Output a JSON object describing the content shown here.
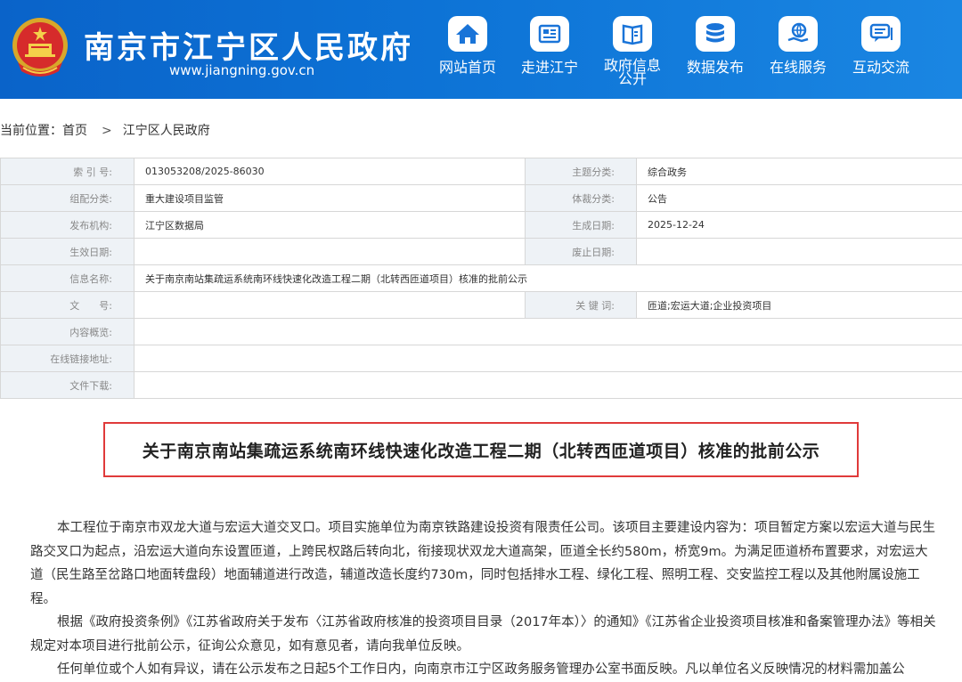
{
  "header": {
    "site_title": "南京市江宁区人民政府",
    "site_url": "www.jiangning.gov.cn",
    "nav": [
      {
        "label": "网站首页",
        "icon": "home-icon"
      },
      {
        "label": "走进江宁",
        "icon": "newspaper-icon"
      },
      {
        "label": "政府信息公开",
        "icon": "book-icon"
      },
      {
        "label": "数据发布",
        "icon": "database-icon"
      },
      {
        "label": "在线服务",
        "icon": "globe-hand-icon"
      },
      {
        "label": "互动交流",
        "icon": "chat-icon"
      }
    ]
  },
  "breadcrumb": {
    "prefix": "当前位置：",
    "home": "首页",
    "separator": ">",
    "current": "江宁区人民政府"
  },
  "meta": {
    "index_label": "索 引 号:",
    "index_value": "013053208/2025-86030",
    "topic_label": "主题分类:",
    "topic_value": "综合政务",
    "org_class_label": "组配分类:",
    "org_class_value": "重大建设项目监管",
    "genre_label": "体裁分类:",
    "genre_value": "公告",
    "publisher_label": "发布机构:",
    "publisher_value": "江宁区数据局",
    "created_label": "生成日期:",
    "created_value": "2025-12-24",
    "effective_label": "生效日期:",
    "effective_value": "",
    "expire_label": "废止日期:",
    "expire_value": "",
    "name_label": "信息名称:",
    "name_value": "关于南京南站集疏运系统南环线快速化改造工程二期（北转西匝道项目）核准的批前公示",
    "docno_label": "文　　号:",
    "docno_value": "",
    "keywords_label": "关 键 词:",
    "keywords_value": "匝道;宏运大道;企业投资项目",
    "overview_label": "内容概览:",
    "overview_value": "",
    "link_label": "在线链接地址:",
    "link_value": "",
    "download_label": "文件下载:",
    "download_value": ""
  },
  "article": {
    "title": "关于南京南站集疏运系统南环线快速化改造工程二期（北转西匝道项目）核准的批前公示",
    "paragraphs": [
      "本工程位于南京市双龙大道与宏运大道交叉口。项目实施单位为南京铁路建设投资有限责任公司。该项目主要建设内容为：项目暂定方案以宏运大道与民生路交叉口为起点，沿宏运大道向东设置匝道，上跨民权路后转向北，衔接现状双龙大道高架，匝道全长约580m，桥宽9m。为满足匝道桥布置要求，对宏运大道（民生路至岔路口地面转盘段）地面辅道进行改造，辅道改造长度约730m，同时包括排水工程、绿化工程、照明工程、交安监控工程以及其他附属设施工程。",
      "根据《政府投资条例》《江苏省政府关于发布〈江苏省政府核准的投资项目目录（2017年本）〉的通知》《江苏省企业投资项目核准和备案管理办法》等相关规定对本项目进行批前公示，征询公众意见，如有意见者，请向我单位反映。",
      "任何单位或个人如有异议，请在公示发布之日起5个工作日内，向南京市江宁区政务服务管理办公室书面反映。凡以单位名义反映情况的材料需加盖公"
    ]
  }
}
